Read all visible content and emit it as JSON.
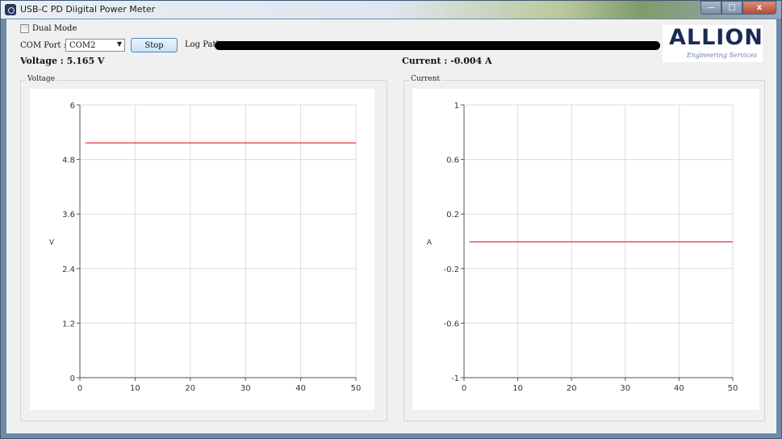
{
  "window": {
    "title": "USB-C PD Diigital Power Meter",
    "caption_buttons": {
      "minimize": "—",
      "maximize": "□",
      "close": "x"
    }
  },
  "controls": {
    "dual_mode_label": "Dual Mode",
    "dual_mode_checked": false,
    "com_port_label": "COM Port :",
    "com_port_value": "COM2",
    "stop_label": "Stop",
    "log_path_label": "Log Path"
  },
  "logo": {
    "name": "ALLION",
    "tagline": "Engineering Services"
  },
  "readings": {
    "voltage": "Voltage : 5.165 V",
    "current": "Current : -0.004 A"
  },
  "colors": {
    "series": "#e8414b",
    "grid": "#dcdcdc",
    "axis": "#555555"
  },
  "chart_data": [
    {
      "type": "line",
      "title": "Voltage",
      "xlabel": "",
      "ylabel": "V",
      "xlim": [
        0,
        50
      ],
      "ylim": [
        0,
        6
      ],
      "x_ticks": [
        0,
        10,
        20,
        30,
        40,
        50
      ],
      "y_ticks": [
        0,
        1.2,
        2.4,
        3.6,
        4.8,
        6
      ],
      "y_tick_labels": [
        "0",
        "1.2",
        "2.4",
        "3.6",
        "4.8",
        "6"
      ],
      "grid": true,
      "series": [
        {
          "x": [
            1,
            50
          ],
          "y": [
            5.165,
            5.165
          ]
        }
      ]
    },
    {
      "type": "line",
      "title": "Current",
      "xlabel": "",
      "ylabel": "A",
      "xlim": [
        0,
        50
      ],
      "ylim": [
        -1,
        1
      ],
      "x_ticks": [
        0,
        10,
        20,
        30,
        40,
        50
      ],
      "y_ticks": [
        -1,
        -0.6,
        -0.2,
        0.2,
        0.6,
        1
      ],
      "y_tick_labels": [
        "-1",
        "-0.6",
        "-0.2",
        "0.2",
        "0.6",
        "1"
      ],
      "grid": true,
      "series": [
        {
          "x": [
            1,
            50
          ],
          "y": [
            -0.004,
            -0.004
          ]
        }
      ]
    }
  ]
}
